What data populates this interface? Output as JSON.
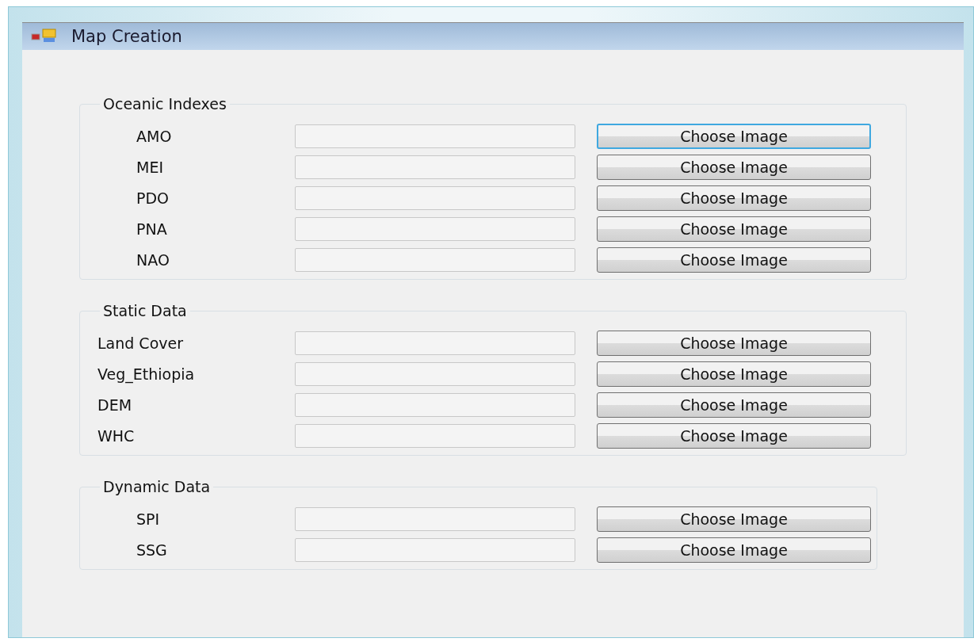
{
  "window": {
    "title": "Map Creation"
  },
  "groups": [
    {
      "title": "Oceanic Indexes",
      "rows": [
        {
          "label": "AMO",
          "button": "Choose Image",
          "focused": true
        },
        {
          "label": "MEI",
          "button": "Choose Image",
          "focused": false
        },
        {
          "label": "PDO",
          "button": "Choose Image",
          "focused": false
        },
        {
          "label": "PNA",
          "button": "Choose Image",
          "focused": false
        },
        {
          "label": "NAO",
          "button": "Choose Image",
          "focused": false
        }
      ]
    },
    {
      "title": "Static Data",
      "rows": [
        {
          "label": "Land Cover",
          "button": "Choose Image",
          "focused": false
        },
        {
          "label": "Veg_Ethiopia",
          "button": "Choose Image",
          "focused": false
        },
        {
          "label": "DEM",
          "button": "Choose Image",
          "focused": false
        },
        {
          "label": "WHC",
          "button": "Choose Image",
          "focused": false
        }
      ]
    },
    {
      "title": "Dynamic Data",
      "rows": [
        {
          "label": "SPI",
          "button": "Choose Image",
          "focused": false
        },
        {
          "label": "SSG",
          "button": "Choose Image",
          "focused": false
        }
      ]
    }
  ]
}
